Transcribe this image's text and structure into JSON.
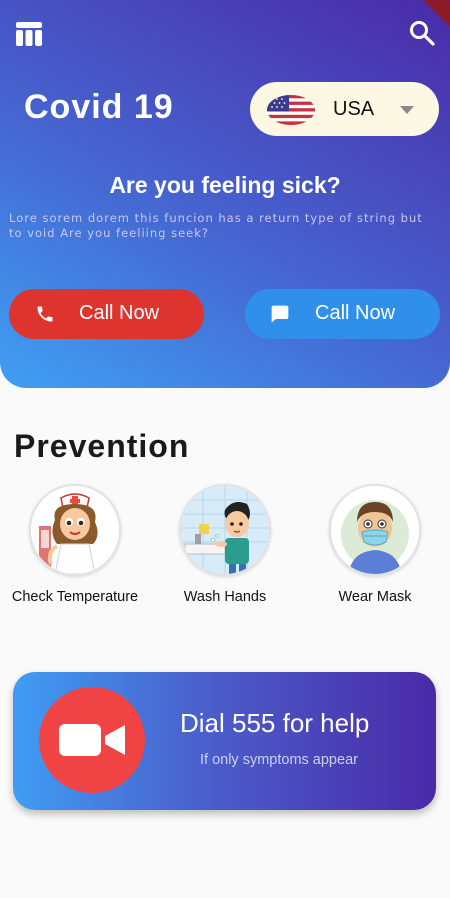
{
  "app": {
    "title": "Covid 19",
    "icons": {
      "menu": "dashboard-icon",
      "search": "search-icon"
    }
  },
  "country_select": {
    "flag": "usa-flag",
    "selected": "USA"
  },
  "hero": {
    "question": "Are you feeling sick?",
    "description": "Lore sorem dorem this funcion has a return type of string but to void Are you feeliing seek?"
  },
  "actions": [
    {
      "label": "Call Now",
      "icon": "phone-icon",
      "color": "#de3430"
    },
    {
      "label": "Call Now",
      "icon": "chat-icon",
      "color": "#2f8fea"
    }
  ],
  "prevention": {
    "title": "Prevention",
    "items": [
      {
        "label": "Check Temperature",
        "icon": "nurse-illustration"
      },
      {
        "label": "Wash Hands",
        "icon": "wash-hands-illustration"
      },
      {
        "label": "Wear Mask",
        "icon": "mask-illustration"
      }
    ]
  },
  "help_card": {
    "title": "Dial 555 for help",
    "subtitle": "If only symptoms appear",
    "icon": "video-camera-icon"
  },
  "colors": {
    "accent_red": "#de3430",
    "accent_blue": "#2f8fea",
    "gradient_start": "#3fa0f3",
    "gradient_end": "#4b2aa6"
  }
}
